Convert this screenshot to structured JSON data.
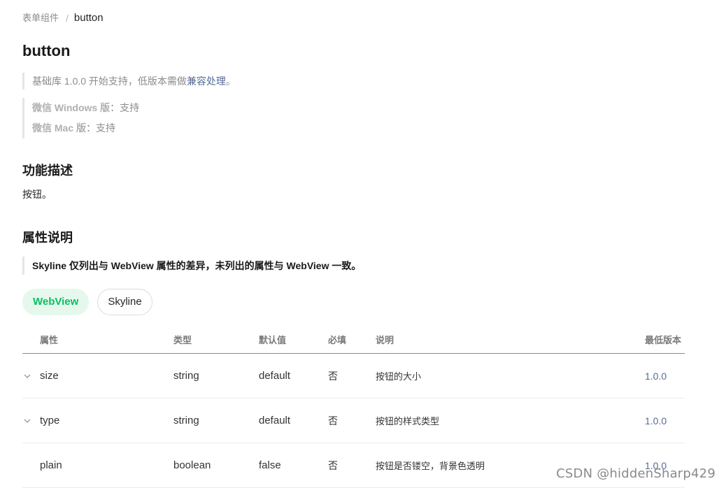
{
  "breadcrumb": {
    "parent": "表单组件",
    "separator": "/",
    "current": "button"
  },
  "page": {
    "title": "button"
  },
  "notes": {
    "version_prefix": "基础库 1.0.0 开始支持，低版本需做",
    "version_link": "兼容处理",
    "version_suffix": "。",
    "windows_label": "微信 Windows 版",
    "windows_value": "：支持",
    "mac_label": "微信 Mac 版",
    "mac_value": "：支持"
  },
  "sections": {
    "description_heading": "功能描述",
    "description_text": "按钮。",
    "attributes_heading": "属性说明",
    "skyline_note": "Skyline 仅列出与 WebView 属性的差异，未列出的属性与 WebView 一致。"
  },
  "tabs": [
    {
      "label": "WebView",
      "active": true
    },
    {
      "label": "Skyline",
      "active": false
    }
  ],
  "table": {
    "headers": {
      "name": "属性",
      "type": "类型",
      "default": "默认值",
      "required": "必填",
      "desc": "说明",
      "version": "最低版本"
    },
    "rows": [
      {
        "name": "size",
        "type": "string",
        "default": "default",
        "required": "否",
        "desc": "按钮的大小",
        "version": "1.0.0",
        "expandable": true
      },
      {
        "name": "type",
        "type": "string",
        "default": "default",
        "required": "否",
        "desc": "按钮的样式类型",
        "version": "1.0.0",
        "expandable": true
      },
      {
        "name": "plain",
        "type": "boolean",
        "default": "false",
        "required": "否",
        "desc": "按钮是否镂空，背景色透明",
        "version": "1.0.0",
        "expandable": false
      }
    ]
  },
  "watermark": "CSDN @hiddenSharp429",
  "colors": {
    "accent_green": "#07c160",
    "tab_active_bg": "#e6f8ed",
    "link": "#576b95"
  }
}
